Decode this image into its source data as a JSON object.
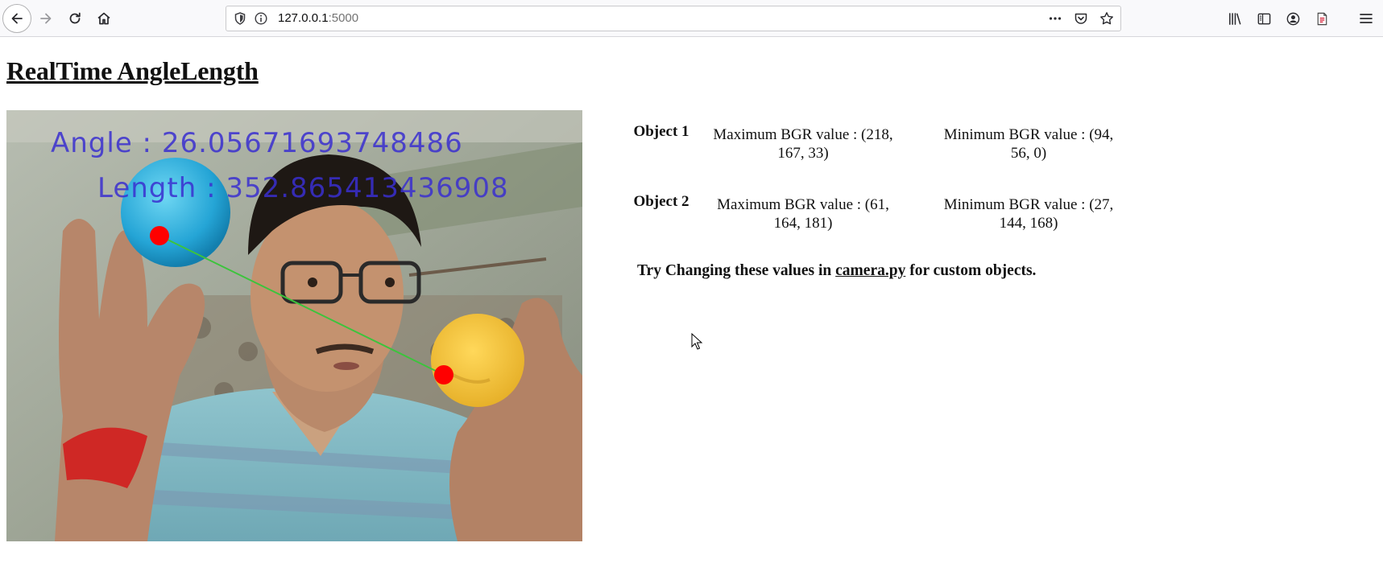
{
  "browser": {
    "url_host": "127.0.0.1",
    "url_port": ":5000",
    "icons": {
      "back": "back-arrow-icon",
      "forward": "forward-arrow-icon",
      "reload": "reload-icon",
      "home": "home-icon",
      "shield": "shield-icon",
      "info": "info-icon",
      "more": "more-horizontal-icon",
      "pocket": "pocket-icon",
      "bookmark": "star-icon",
      "library": "library-icon",
      "sidebar": "sidebar-icon",
      "account": "account-icon",
      "pdf": "pdf-icon",
      "menu": "hamburger-menu-icon"
    }
  },
  "page": {
    "title": "RealTime AngleLength"
  },
  "video": {
    "angle_text": "Angle : 26.05671693748486",
    "length_text": "Length : 352.865413436908",
    "overlay_color": "#3a2fd0",
    "marker_color": "#ff0000",
    "line_color": "#3cc43c"
  },
  "objects": [
    {
      "label": "Object 1",
      "max_text": "Maximum BGR value : (218, 167, 33)",
      "min_text": "Minimum BGR value : (94, 56, 0)"
    },
    {
      "label": "Object 2",
      "max_text": "Maximum BGR value : (61, 164, 181)",
      "min_text": "Minimum BGR value : (27, 144, 168)"
    }
  ],
  "hint": {
    "prefix": "Try Changing these values in ",
    "link": "camera.py",
    "suffix": " for custom objects."
  }
}
